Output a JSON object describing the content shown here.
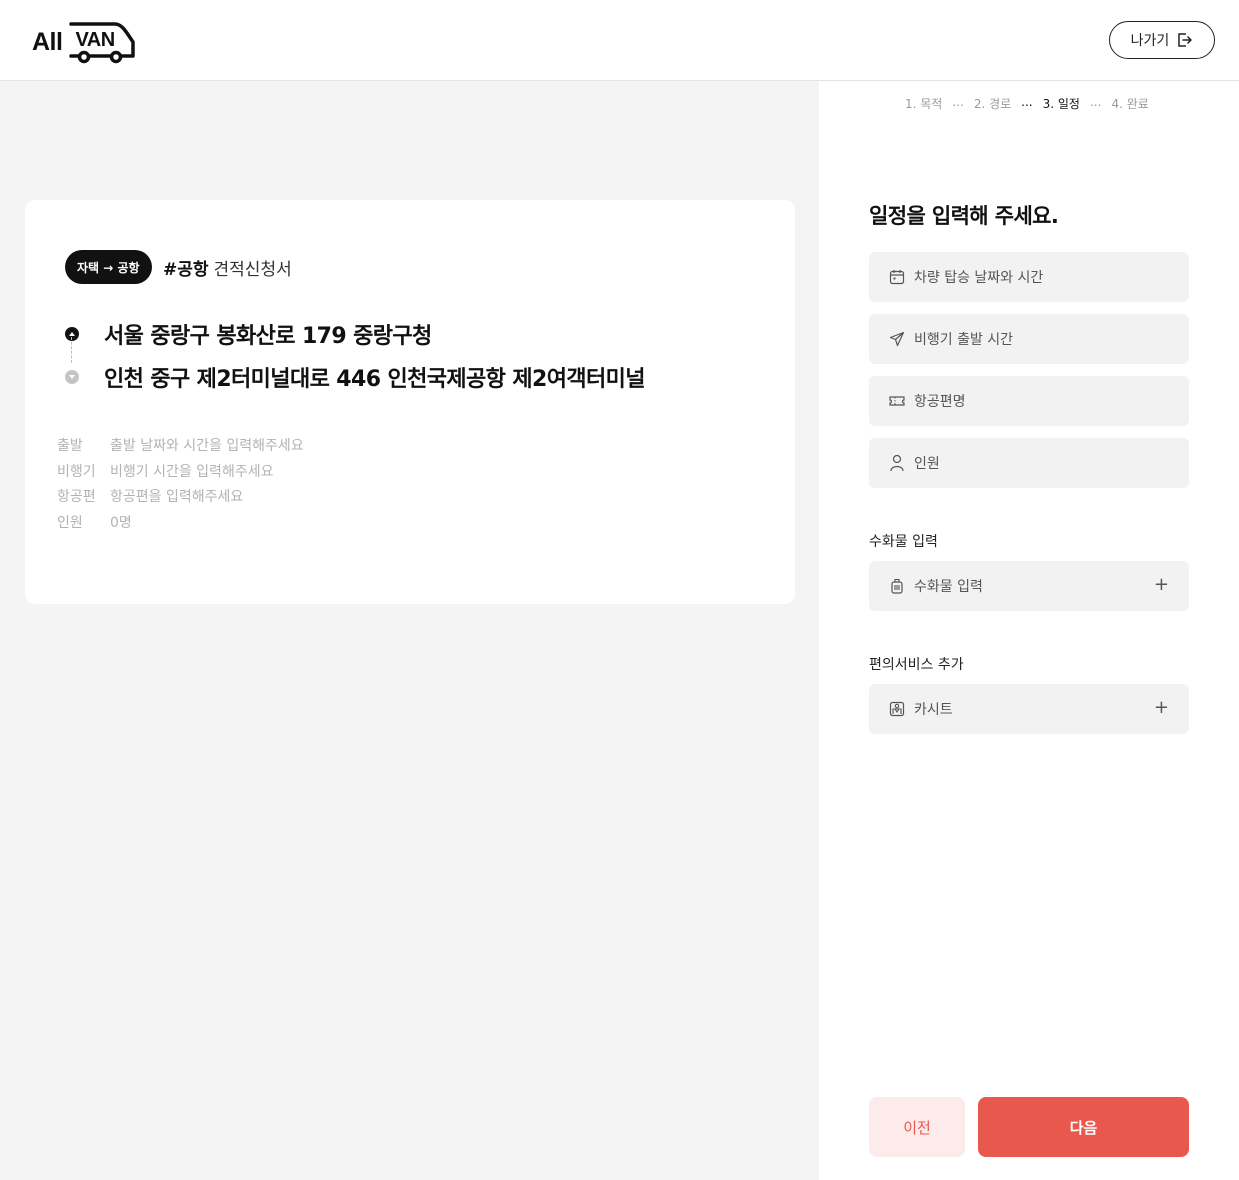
{
  "header": {
    "logo_all": "All",
    "logo_van": "VAN",
    "exit_label": "나가기",
    "exit_icon": "logout-icon"
  },
  "summary": {
    "trip_type": "자택 → 공항",
    "hashtag": "#공항",
    "title": "견적신청서",
    "origin": "서울 중랑구 봉화산로 179 중랑구청",
    "destination": "인천 중구 제2터미널대로 446 인천국제공항 제2여객터미널",
    "details": [
      {
        "key": "출발",
        "value": "출발 날짜와 시간을 입력해주세요"
      },
      {
        "key": "비행기",
        "value": "비행기 시간을 입력해주세요"
      },
      {
        "key": "항공편",
        "value": "항공편을 입력해주세요"
      },
      {
        "key": "인원",
        "value": "0명"
      }
    ]
  },
  "steps": {
    "items": [
      "1. 목적",
      "2. 경로",
      "3. 일정",
      "4. 완료"
    ],
    "separator": "...",
    "active_index": 2
  },
  "form": {
    "title": "일정을 입력해 주세요.",
    "fields": [
      {
        "label": "차량 탑승 날짜와 시간",
        "icon": "calendar-icon"
      },
      {
        "label": "비행기 출발 시간",
        "icon": "airplane-icon"
      },
      {
        "label": "항공편명",
        "icon": "ticket-icon"
      },
      {
        "label": "인원",
        "icon": "person-icon"
      }
    ],
    "luggage_section": "수화물 입력",
    "luggage_field": "수화물 입력",
    "luggage_icon": "luggage-icon",
    "service_section": "편의서비스 추가",
    "service_field": "카시트",
    "service_icon": "car-seat-icon",
    "plus": "+"
  },
  "buttons": {
    "prev": "이전",
    "next": "다음"
  },
  "colors": {
    "accent": "#e8584d",
    "accent_light": "#fdeaea",
    "panel_bg": "#f4f4f4",
    "field_bg": "#f2f2f2"
  }
}
